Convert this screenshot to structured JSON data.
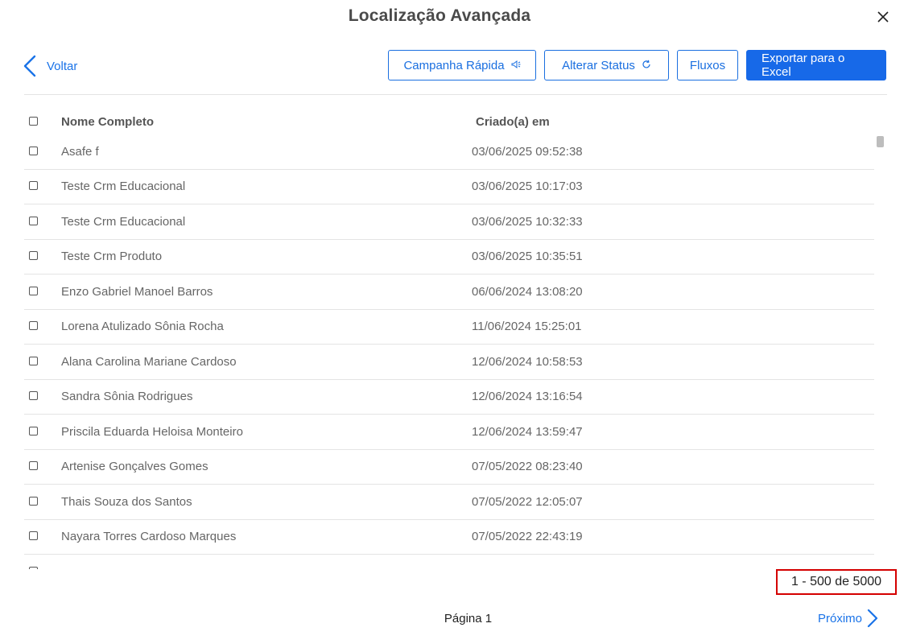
{
  "dialog": {
    "title": "Localização Avançada"
  },
  "nav": {
    "back_label": "Voltar"
  },
  "toolbar": {
    "campanha_label": "Campanha Rápida",
    "status_label": "Alterar Status",
    "fluxos_label": "Fluxos",
    "export_label": "Exportar para o Excel"
  },
  "table": {
    "headers": {
      "name": "Nome Completo",
      "created": "Criado(a) em"
    },
    "rows": [
      {
        "name": "Asafe f",
        "created": "03/06/2025 09:52:38"
      },
      {
        "name": "Teste Crm Educacional",
        "created": "03/06/2025 10:17:03"
      },
      {
        "name": "Teste Crm Educacional",
        "created": "03/06/2025 10:32:33"
      },
      {
        "name": "Teste Crm Produto",
        "created": "03/06/2025 10:35:51"
      },
      {
        "name": "Enzo Gabriel Manoel Barros",
        "created": "06/06/2024 13:08:20"
      },
      {
        "name": "Lorena Atulizado Sônia Rocha",
        "created": "11/06/2024 15:25:01"
      },
      {
        "name": "Alana Carolina Mariane Cardoso",
        "created": "12/06/2024 10:58:53"
      },
      {
        "name": "Sandra Sônia Rodrigues",
        "created": "12/06/2024 13:16:54"
      },
      {
        "name": "Priscila Eduarda Heloisa Monteiro",
        "created": "12/06/2024 13:59:47"
      },
      {
        "name": "Artenise Gonçalves Gomes",
        "created": "07/05/2022 08:23:40"
      },
      {
        "name": "Thais Souza dos Santos",
        "created": "07/05/2022 12:05:07"
      },
      {
        "name": "Nayara Torres Cardoso Marques",
        "created": "07/05/2022 22:43:19"
      }
    ]
  },
  "pagination": {
    "range_text": "1 - 500 de 5000",
    "page_text": "Página 1",
    "next_label": "Próximo"
  },
  "colors": {
    "accent": "#1769e8",
    "highlight_border": "#d40000"
  }
}
